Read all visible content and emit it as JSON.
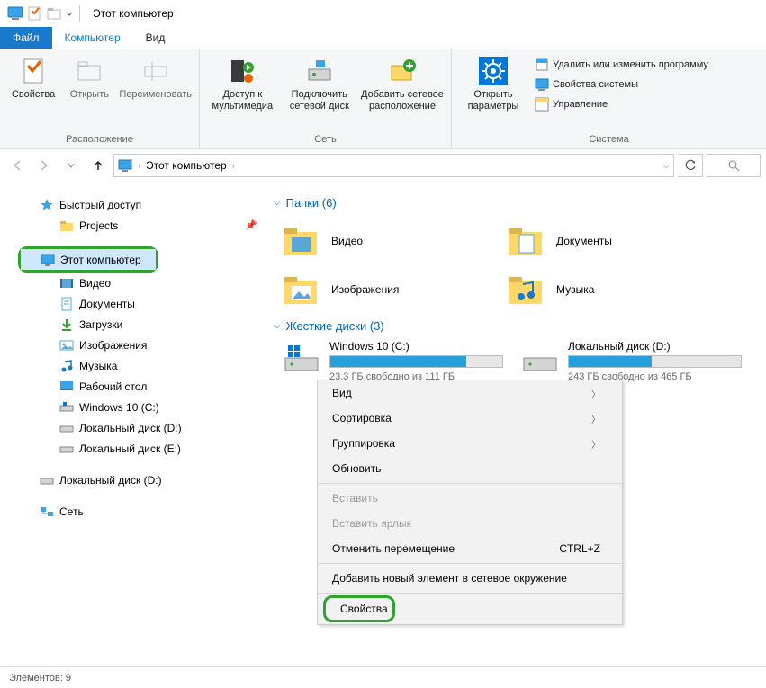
{
  "title": "Этот компьютер",
  "tabs": {
    "file": "Файл",
    "computer": "Компьютер",
    "view": "Вид"
  },
  "ribbon": {
    "group1": {
      "properties": "Свойства",
      "open": "Открыть",
      "rename": "Переименовать",
      "label": "Расположение"
    },
    "group2": {
      "media": "Доступ к мультимедиа",
      "mapdrive": "Подключить сетевой диск",
      "addnet": "Добавить сетевое расположение",
      "label": "Сеть"
    },
    "group3": {
      "settings": "Открыть параметры",
      "uninstall": "Удалить или изменить программу",
      "sysprop": "Свойства системы",
      "manage": "Управление",
      "label": "Система"
    }
  },
  "addr": {
    "crumb": "Этот компьютер"
  },
  "nav": {
    "quick": "Быстрый доступ",
    "projects": "Projects",
    "thispc": "Этот компьютер",
    "videos": "Видео",
    "documents": "Документы",
    "downloads": "Загрузки",
    "pictures": "Изображения",
    "music": "Музыка",
    "desktop": "Рабочий стол",
    "drv_c": "Windows 10 (C:)",
    "drv_d": "Локальный диск (D:)",
    "drv_e": "Локальный диск (E:)",
    "drv_d2": "Локальный диск (D:)",
    "network": "Сеть"
  },
  "content": {
    "folders_head": "Папки (6)",
    "videos": "Видео",
    "documents": "Документы",
    "pictures": "Изображения",
    "music": "Музыка",
    "drives_head": "Жесткие диски (3)",
    "drive_c_name": "Windows 10 (C:)",
    "drive_c_free": "23,3 ГБ свободно из 111 ГБ",
    "drive_c_pct": 79,
    "drive_d_name": "Локальный диск (D:)",
    "drive_d_free": "243 ГБ свободно из 465 ГБ",
    "drive_d_pct": 48
  },
  "ctx": {
    "view": "Вид",
    "sort": "Сортировка",
    "group": "Группировка",
    "refresh": "Обновить",
    "paste": "Вставить",
    "paste_shortcut": "Вставить ярлык",
    "undo_move": "Отменить перемещение",
    "undo_key": "CTRL+Z",
    "add_net": "Добавить новый элемент в сетевое окружение",
    "properties": "Свойства"
  },
  "status": {
    "items": "Элементов: 9"
  }
}
